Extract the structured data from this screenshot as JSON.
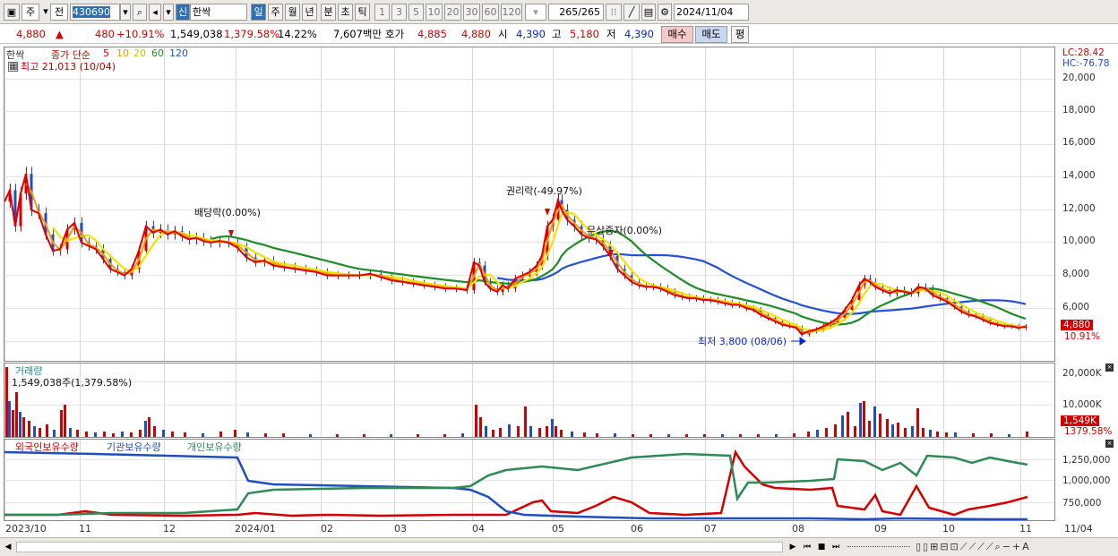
{
  "toolbar": {
    "market_label": "주",
    "prev_label": "전",
    "code_value": "430690",
    "stock_prefix": "신",
    "stock_name": "한싹",
    "periods": [
      "일",
      "주",
      "월",
      "년",
      "분",
      "초",
      "틱"
    ],
    "minute_steps": [
      "1",
      "3",
      "5",
      "10",
      "20",
      "30",
      "60",
      "120"
    ],
    "count_value": "265",
    "count_total": "/265",
    "date_value": "2024/11/04"
  },
  "quote": {
    "price": "4,880",
    "arrow": "▲",
    "change": "480",
    "change_pct": "+10.91%",
    "volume": "1,549,038",
    "volume_ratio": "1,379.58%",
    "turnover": "14.22%",
    "amount": "7,607백만",
    "bid_label": "호가",
    "bid_value": "4,885",
    "ask_value": "4,880",
    "open_label": "시",
    "open_value": "4,390",
    "high_label": "고",
    "high_value": "5,180",
    "low_label": "저",
    "low_value": "4,390",
    "buy_label": "매수",
    "sell_label": "매도",
    "eval_label": "평"
  },
  "price_panel": {
    "stock_tag": "한싹",
    "ma_label": "종가 단순",
    "ma_periods": [
      "5",
      "10",
      "20",
      "60",
      "120"
    ],
    "high_note": "최고 21,013 (10/04)",
    "lc": "LC:28.42",
    "hc": "HC:-76.78",
    "y_ticks": [
      "20,000",
      "18,000",
      "16,000",
      "14,000",
      "12,000",
      "10,000",
      "8,000",
      "6,000"
    ],
    "current_price_tag": "4,880",
    "current_pct_tag": "10.91%",
    "annotations": {
      "dividend": "배당락(0.00%)",
      "rights": "권리락(-49.97%)",
      "bonus": "무상증자(0.00%)",
      "low": "최저 3,800 (08/06)"
    }
  },
  "volume_panel": {
    "title": "거래량",
    "value": "1,549,038주(1,379.58%)",
    "y_ticks": [
      "20,000K",
      "10,000K"
    ],
    "current_tag": "1,549K",
    "current_pct": "1379.58%"
  },
  "holding_panel": {
    "foreign": "외국인보유수량",
    "institution": "기관보유수량",
    "individual": "개인보유수량",
    "y_ticks": [
      "1,250,000",
      "1,000,000",
      "750,000"
    ]
  },
  "x_axis": [
    "2023/10",
    "11",
    "12",
    "2024/01",
    "02",
    "03",
    "04",
    "05",
    "06",
    "07",
    "08",
    "09",
    "10",
    "11",
    "11/04"
  ],
  "colors": {
    "ma5": "#e00000",
    "ma10": "#f59a00",
    "ma20": "#f2e200",
    "ma60": "#1f8c2a",
    "ma120": "#2450d8",
    "up": "#d40000",
    "down": "#1f4fbf",
    "foreign": "#d40000",
    "institution": "#1f4fbf",
    "individual": "#2e8b57"
  }
}
